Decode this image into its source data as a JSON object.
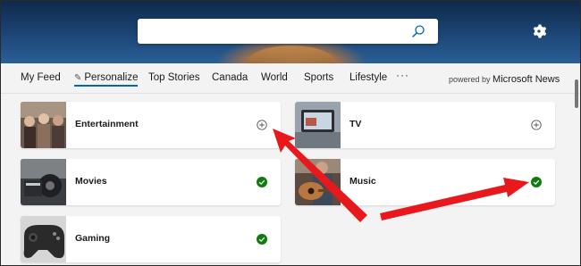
{
  "search": {
    "placeholder": ""
  },
  "nav": {
    "items": [
      {
        "label": "My Feed"
      },
      {
        "label": "Personalize"
      },
      {
        "label": "Top Stories"
      },
      {
        "label": "Canada"
      },
      {
        "label": "World"
      },
      {
        "label": "Sports"
      },
      {
        "label": "Lifestyle"
      }
    ],
    "more": "···",
    "powered_prefix": "powered by",
    "powered_brand": "Microsoft News"
  },
  "topics": [
    {
      "label": "Entertainment",
      "state": "add",
      "icon": "plus-circle-icon"
    },
    {
      "label": "TV",
      "state": "add",
      "icon": "plus-circle-icon"
    },
    {
      "label": "Movies",
      "state": "followed",
      "icon": "check-circle-icon"
    },
    {
      "label": "Music",
      "state": "followed",
      "icon": "check-circle-icon"
    },
    {
      "label": "Gaming",
      "state": "followed",
      "icon": "check-circle-icon"
    }
  ],
  "colors": {
    "accent": "#0067b8",
    "check": "#107c10",
    "arrow": "#e8191c"
  }
}
